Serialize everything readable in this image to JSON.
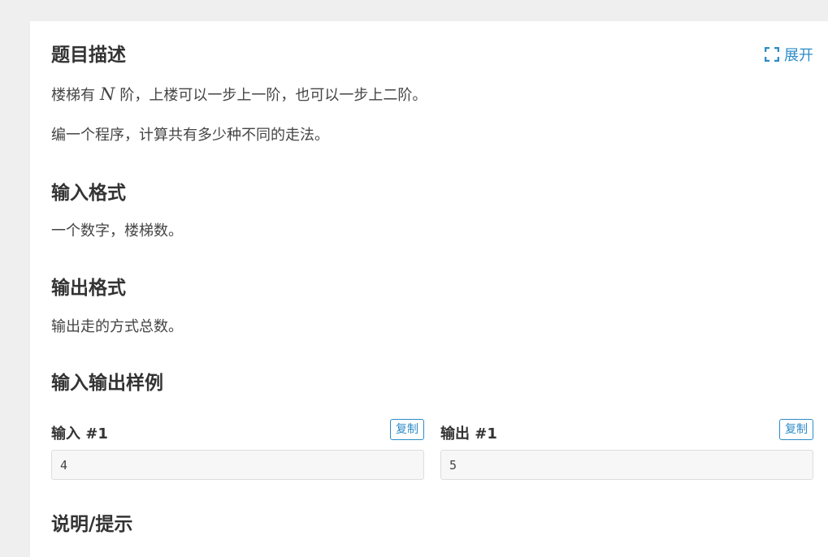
{
  "description": {
    "title": "题目描述",
    "expand_label": "展开",
    "line1_pre": "楼梯有",
    "line1_math": "N",
    "line1_post": "阶，上楼可以一步上一阶，也可以一步上二阶。",
    "line2": "编一个程序，计算共有多少种不同的走法。"
  },
  "input_format": {
    "title": "输入格式",
    "text": "一个数字，楼梯数。"
  },
  "output_format": {
    "title": "输出格式",
    "text": "输出走的方式总数。"
  },
  "samples": {
    "title": "输入输出样例",
    "input": {
      "label": "输入 #1",
      "copy_label": "复制",
      "value": "4"
    },
    "output": {
      "label": "输出 #1",
      "copy_label": "复制",
      "value": "5"
    }
  },
  "hint": {
    "title": "说明/提示"
  },
  "colors": {
    "accent": "#2d8cc8",
    "page_bg": "#efefef",
    "card_bg": "#ffffff",
    "sample_bg": "#f7f7f7"
  }
}
